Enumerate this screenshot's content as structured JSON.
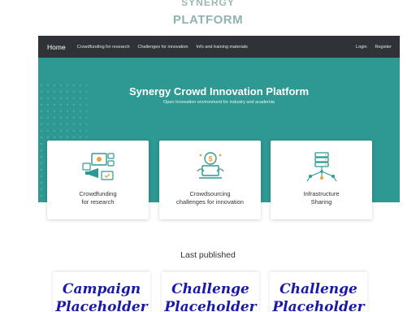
{
  "logo": {
    "line1": "SYNERGY",
    "line2": "PLATFORM"
  },
  "nav": {
    "home": "Home",
    "items": [
      "Crowdfunding for research",
      "Challenges for innovation",
      "Info and training materials"
    ],
    "login": "Login",
    "register": "Register"
  },
  "hero": {
    "title": "Synergy Crowd Innovation Platform",
    "subtitle": "Open Innovation environment for industry and academia"
  },
  "cards": [
    {
      "line1": "Crowdfunding",
      "line2": "for research",
      "icon": "crowdfunding-icon"
    },
    {
      "line1": "Crowdsourcing",
      "line2": "challenges for innovation",
      "icon": "crowdsourcing-icon"
    },
    {
      "line1": "Infrastructure",
      "line2": "Sharing",
      "icon": "infrastructure-icon"
    }
  ],
  "last_published": "Last published",
  "tiles": [
    {
      "line1": "Campaign",
      "line2": "Placeholder"
    },
    {
      "line1": "Challenge",
      "line2": "Placeholder"
    },
    {
      "line1": "Challenge",
      "line2": "Placeholder"
    }
  ],
  "colors": {
    "teal": "#2e9892",
    "navbar": "#2f3236",
    "placeholder_text": "#1a1aa8"
  }
}
